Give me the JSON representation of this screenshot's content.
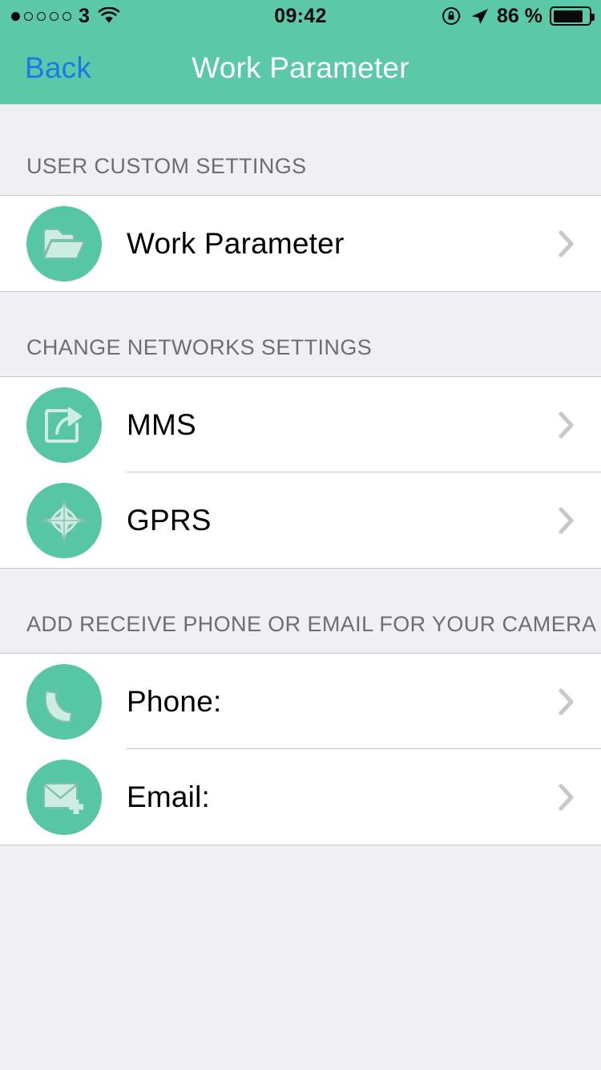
{
  "status_bar": {
    "signal_dots_total": 5,
    "signal_dots_filled": 1,
    "carrier": "3",
    "wifi_icon": "wifi-icon",
    "time": "09:42",
    "rotation_lock_icon": "rotation-lock-icon",
    "location_icon": "location-arrow-icon",
    "battery_percent": "86 %",
    "battery_level": 86,
    "battery_icon": "battery-icon"
  },
  "navbar": {
    "back_label": "Back",
    "title": "Work Parameter",
    "background_color": "#5BC9A8",
    "back_color": "#1A7BE8",
    "title_color": "#FFFFFF"
  },
  "colors": {
    "accent_teal": "#5BC9A8",
    "icon_circle": "#57C6A4",
    "icon_glyph": "#CDEDE2",
    "page_background": "#EFEFF4",
    "row_background": "#FFFFFF",
    "separator": "#C8C7CC",
    "section_header_text": "#6D6D72",
    "chevron": "#C7C7CC"
  },
  "sections": [
    {
      "header": "USER CUSTOM SETTINGS",
      "rows": [
        {
          "label": "Work Parameter",
          "icon": "folder-icon",
          "chevron": "chevron-right-icon"
        }
      ]
    },
    {
      "header": "CHANGE NETWORKS SETTINGS",
      "rows": [
        {
          "label": "MMS",
          "icon": "share-square-icon",
          "chevron": "chevron-right-icon"
        },
        {
          "label": "GPRS",
          "icon": "compass-star-icon",
          "chevron": "chevron-right-icon"
        }
      ]
    },
    {
      "header": "ADD RECEIVE PHONE OR EMAIL FOR YOUR CAMERA",
      "rows": [
        {
          "label": "Phone:",
          "icon": "phone-handset-icon",
          "chevron": "chevron-right-icon"
        },
        {
          "label": "Email:",
          "icon": "envelope-plus-icon",
          "chevron": "chevron-right-icon"
        }
      ]
    }
  ]
}
